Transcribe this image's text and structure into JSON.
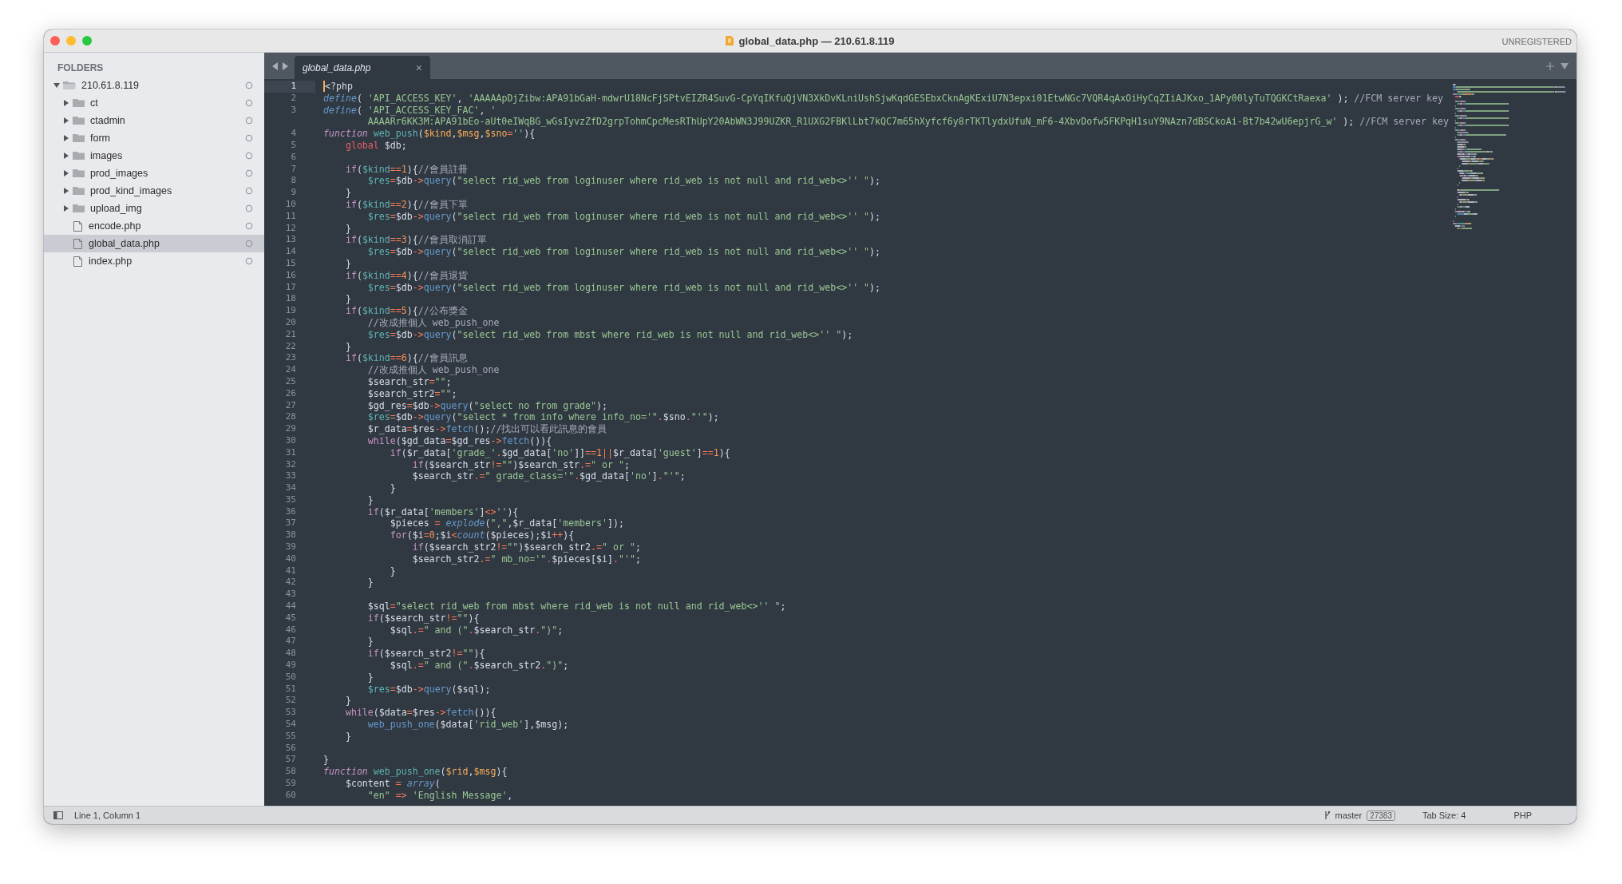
{
  "window": {
    "title": "global_data.php — 210.61.8.119",
    "registration": "UNREGISTERED"
  },
  "sidebar": {
    "heading": "FOLDERS",
    "items": [
      {
        "name": "210.61.8.119",
        "kind": "folder",
        "expanded": true,
        "selected": false,
        "children": [
          {
            "name": "ct",
            "kind": "folder",
            "expanded": false,
            "selected": false
          },
          {
            "name": "ctadmin",
            "kind": "folder",
            "expanded": false,
            "selected": false
          },
          {
            "name": "form",
            "kind": "folder",
            "expanded": false,
            "selected": false
          },
          {
            "name": "images",
            "kind": "folder",
            "expanded": false,
            "selected": false
          },
          {
            "name": "prod_images",
            "kind": "folder",
            "expanded": false,
            "selected": false
          },
          {
            "name": "prod_kind_images",
            "kind": "folder",
            "expanded": false,
            "selected": false
          },
          {
            "name": "upload_img",
            "kind": "folder",
            "expanded": false,
            "selected": false
          },
          {
            "name": "encode.php",
            "kind": "file",
            "selected": false
          },
          {
            "name": "global_data.php",
            "kind": "file",
            "selected": true
          },
          {
            "name": "index.php",
            "kind": "file",
            "selected": false
          }
        ]
      }
    ]
  },
  "tabs": [
    {
      "label": "global_data.php",
      "selected": true,
      "close": "×"
    }
  ],
  "editor": {
    "lines": [
      {
        "number": "1",
        "current": true,
        "tokens": [
          {
            "kind": "p",
            "text": "<?php"
          }
        ]
      },
      {
        "number": "2",
        "current": false,
        "tokens": [
          {
            "kind": "fi",
            "text": "define"
          },
          {
            "kind": "p",
            "text": "( "
          },
          {
            "kind": "s",
            "text": "'API_ACCESS_KEY'"
          },
          {
            "kind": "p",
            "text": ", "
          },
          {
            "kind": "s",
            "text": "'AAAAApDjZibw:APA91bGaH-mdwrU18NcFjSPtvEIZR4SuvG-CpYqIKfuQjVN3XkDvKLniUshSjwKqdGESEbxCknAgKExiU7N3epxi01EtwNGc7VQR4qAxOiHyCqZIiAJKxo_1APy00lyTuTQGKCtRaexa'"
          },
          {
            "kind": "p",
            "text": " ); "
          },
          {
            "kind": "c",
            "text": "//FCM server key"
          }
        ]
      },
      {
        "number": "3",
        "current": false,
        "tokens": [
          {
            "kind": "fi",
            "text": "define"
          },
          {
            "kind": "p",
            "text": "( "
          },
          {
            "kind": "s",
            "text": "'API_ACCESS_KEY_FAC'"
          },
          {
            "kind": "p",
            "text": ", "
          },
          {
            "kind": "s",
            "text": "'"
          }
        ]
      },
      {
        "current": false,
        "tokens": [
          {
            "kind": "s",
            "text": "        AAAARr6KK3M:APA91bEo-aUt0eIWqBG_wGsIyvzZfD2grpTohmCpcMesRThUpY20AbWN3J99UZKR_R1UXG2FBKlLbt7kQC7m65hXyfcf6y8rTKTlydxUfuN_mF6-4XbvDofw5FKPqH1suY9NAzn7dBSCkoAi-Bt7b42wU6epjrG_w'"
          },
          {
            "kind": "p",
            "text": " ); "
          },
          {
            "kind": "c",
            "text": "//FCM server key"
          }
        ]
      },
      {
        "number": "4",
        "current": false,
        "tokens": [
          {
            "kind": "fn",
            "text": "function"
          },
          {
            "kind": "v",
            "text": " web_push"
          },
          {
            "kind": "p",
            "text": "("
          },
          {
            "kind": "a",
            "text": "$kind"
          },
          {
            "kind": "p",
            "text": ","
          },
          {
            "kind": "a",
            "text": "$msg"
          },
          {
            "kind": "p",
            "text": ","
          },
          {
            "kind": "a",
            "text": "$sno"
          },
          {
            "kind": "o",
            "text": "="
          },
          {
            "kind": "s",
            "text": "''"
          },
          {
            "kind": "p",
            "text": "){"
          }
        ]
      },
      {
        "number": "5",
        "current": false,
        "tokens": [
          {
            "kind": "g",
            "text": "    global"
          },
          {
            "kind": "p",
            "text": " $db;"
          }
        ]
      },
      {
        "number": "6",
        "current": false
      },
      {
        "number": "7",
        "current": false,
        "tokens": [
          {
            "kind": "k",
            "text": "    if"
          },
          {
            "kind": "p",
            "text": "("
          },
          {
            "kind": "v",
            "text": "$kind"
          },
          {
            "kind": "o",
            "text": "=="
          },
          {
            "kind": "n",
            "text": "1"
          },
          {
            "kind": "p",
            "text": "){"
          },
          {
            "kind": "c",
            "text": "//會員註冊"
          }
        ]
      },
      {
        "number": "8",
        "current": false,
        "tokens": [
          {
            "kind": "v",
            "text": "        $res"
          },
          {
            "kind": "o",
            "text": "="
          },
          {
            "kind": "p",
            "text": "$db"
          },
          {
            "kind": "o",
            "text": "->"
          },
          {
            "kind": "f",
            "text": "query"
          },
          {
            "kind": "p",
            "text": "("
          },
          {
            "kind": "s",
            "text": "\"select rid_web from loginuser where rid_web is not null and rid_web<>'' \""
          },
          {
            "kind": "p",
            "text": ");"
          }
        ]
      },
      {
        "number": "9",
        "current": false,
        "tokens": [
          {
            "kind": "p",
            "text": "    }"
          }
        ]
      },
      {
        "number": "10",
        "current": false,
        "tokens": [
          {
            "kind": "k",
            "text": "    if"
          },
          {
            "kind": "p",
            "text": "("
          },
          {
            "kind": "v",
            "text": "$kind"
          },
          {
            "kind": "o",
            "text": "=="
          },
          {
            "kind": "n",
            "text": "2"
          },
          {
            "kind": "p",
            "text": "){"
          },
          {
            "kind": "c",
            "text": "//會員下單"
          }
        ]
      },
      {
        "number": "11",
        "current": false,
        "tokens": [
          {
            "kind": "v",
            "text": "        $res"
          },
          {
            "kind": "o",
            "text": "="
          },
          {
            "kind": "p",
            "text": "$db"
          },
          {
            "kind": "o",
            "text": "->"
          },
          {
            "kind": "f",
            "text": "query"
          },
          {
            "kind": "p",
            "text": "("
          },
          {
            "kind": "s",
            "text": "\"select rid_web from loginuser where rid_web is not null and rid_web<>'' \""
          },
          {
            "kind": "p",
            "text": ");"
          }
        ]
      },
      {
        "number": "12",
        "current": false,
        "tokens": [
          {
            "kind": "p",
            "text": "    }"
          }
        ]
      },
      {
        "number": "13",
        "current": false,
        "tokens": [
          {
            "kind": "k",
            "text": "    if"
          },
          {
            "kind": "p",
            "text": "("
          },
          {
            "kind": "v",
            "text": "$kind"
          },
          {
            "kind": "o",
            "text": "=="
          },
          {
            "kind": "n",
            "text": "3"
          },
          {
            "kind": "p",
            "text": "){"
          },
          {
            "kind": "c",
            "text": "//會員取消訂單"
          }
        ]
      },
      {
        "number": "14",
        "current": false,
        "tokens": [
          {
            "kind": "v",
            "text": "        $res"
          },
          {
            "kind": "o",
            "text": "="
          },
          {
            "kind": "p",
            "text": "$db"
          },
          {
            "kind": "o",
            "text": "->"
          },
          {
            "kind": "f",
            "text": "query"
          },
          {
            "kind": "p",
            "text": "("
          },
          {
            "kind": "s",
            "text": "\"select rid_web from loginuser where rid_web is not null and rid_web<>'' \""
          },
          {
            "kind": "p",
            "text": ");"
          }
        ]
      },
      {
        "number": "15",
        "current": false,
        "tokens": [
          {
            "kind": "p",
            "text": "    }"
          }
        ]
      },
      {
        "number": "16",
        "current": false,
        "tokens": [
          {
            "kind": "k",
            "text": "    if"
          },
          {
            "kind": "p",
            "text": "("
          },
          {
            "kind": "v",
            "text": "$kind"
          },
          {
            "kind": "o",
            "text": "=="
          },
          {
            "kind": "n",
            "text": "4"
          },
          {
            "kind": "p",
            "text": "){"
          },
          {
            "kind": "c",
            "text": "//會員退貨"
          }
        ]
      },
      {
        "number": "17",
        "current": false,
        "tokens": [
          {
            "kind": "v",
            "text": "        $res"
          },
          {
            "kind": "o",
            "text": "="
          },
          {
            "kind": "p",
            "text": "$db"
          },
          {
            "kind": "o",
            "text": "->"
          },
          {
            "kind": "f",
            "text": "query"
          },
          {
            "kind": "p",
            "text": "("
          },
          {
            "kind": "s",
            "text": "\"select rid_web from loginuser where rid_web is not null and rid_web<>'' \""
          },
          {
            "kind": "p",
            "text": ");"
          }
        ]
      },
      {
        "number": "18",
        "current": false,
        "tokens": [
          {
            "kind": "p",
            "text": "    }"
          }
        ]
      },
      {
        "number": "19",
        "current": false,
        "tokens": [
          {
            "kind": "k",
            "text": "    if"
          },
          {
            "kind": "p",
            "text": "("
          },
          {
            "kind": "v",
            "text": "$kind"
          },
          {
            "kind": "o",
            "text": "=="
          },
          {
            "kind": "n",
            "text": "5"
          },
          {
            "kind": "p",
            "text": "){"
          },
          {
            "kind": "c",
            "text": "//公布獎金"
          }
        ]
      },
      {
        "number": "20",
        "current": false,
        "tokens": [
          {
            "kind": "c",
            "text": "        //改成推個人 web_push_one"
          }
        ]
      },
      {
        "number": "21",
        "current": false,
        "tokens": [
          {
            "kind": "v",
            "text": "        $res"
          },
          {
            "kind": "o",
            "text": "="
          },
          {
            "kind": "p",
            "text": "$db"
          },
          {
            "kind": "o",
            "text": "->"
          },
          {
            "kind": "f",
            "text": "query"
          },
          {
            "kind": "p",
            "text": "("
          },
          {
            "kind": "s",
            "text": "\"select rid_web from mbst where rid_web is not null and rid_web<>'' \""
          },
          {
            "kind": "p",
            "text": ");"
          }
        ]
      },
      {
        "number": "22",
        "current": false,
        "tokens": [
          {
            "kind": "p",
            "text": "    }"
          }
        ]
      },
      {
        "number": "23",
        "current": false,
        "tokens": [
          {
            "kind": "k",
            "text": "    if"
          },
          {
            "kind": "p",
            "text": "("
          },
          {
            "kind": "v",
            "text": "$kind"
          },
          {
            "kind": "o",
            "text": "=="
          },
          {
            "kind": "n",
            "text": "6"
          },
          {
            "kind": "p",
            "text": "){"
          },
          {
            "kind": "c",
            "text": "//會員訊息"
          }
        ]
      },
      {
        "number": "24",
        "current": false,
        "tokens": [
          {
            "kind": "c",
            "text": "        //改成推個人 web_push_one"
          }
        ]
      },
      {
        "number": "25",
        "current": false,
        "tokens": [
          {
            "kind": "p",
            "text": "        $search_str"
          },
          {
            "kind": "o",
            "text": "="
          },
          {
            "kind": "s",
            "text": "\"\""
          },
          {
            "kind": "p",
            "text": ";"
          }
        ]
      },
      {
        "number": "26",
        "current": false,
        "tokens": [
          {
            "kind": "p",
            "text": "        $search_str2"
          },
          {
            "kind": "o",
            "text": "="
          },
          {
            "kind": "s",
            "text": "\"\""
          },
          {
            "kind": "p",
            "text": ";"
          }
        ]
      },
      {
        "number": "27",
        "current": false,
        "tokens": [
          {
            "kind": "p",
            "text": "        $gd_res"
          },
          {
            "kind": "o",
            "text": "="
          },
          {
            "kind": "p",
            "text": "$db"
          },
          {
            "kind": "o",
            "text": "->"
          },
          {
            "kind": "f",
            "text": "query"
          },
          {
            "kind": "p",
            "text": "("
          },
          {
            "kind": "s",
            "text": "\"select no from grade\""
          },
          {
            "kind": "p",
            "text": ");"
          }
        ]
      },
      {
        "number": "28",
        "current": false,
        "tokens": [
          {
            "kind": "v",
            "text": "        $res"
          },
          {
            "kind": "o",
            "text": "="
          },
          {
            "kind": "p",
            "text": "$db"
          },
          {
            "kind": "o",
            "text": "->"
          },
          {
            "kind": "f",
            "text": "query"
          },
          {
            "kind": "p",
            "text": "("
          },
          {
            "kind": "s",
            "text": "\"select * from info where info_no='\""
          },
          {
            "kind": "o",
            "text": "."
          },
          {
            "kind": "p",
            "text": "$sno"
          },
          {
            "kind": "o",
            "text": "."
          },
          {
            "kind": "s",
            "text": "\"'\""
          },
          {
            "kind": "p",
            "text": ");"
          }
        ]
      },
      {
        "number": "29",
        "current": false,
        "tokens": [
          {
            "kind": "p",
            "text": "        $r_data"
          },
          {
            "kind": "o",
            "text": "="
          },
          {
            "kind": "p",
            "text": "$res"
          },
          {
            "kind": "o",
            "text": "->"
          },
          {
            "kind": "f",
            "text": "fetch"
          },
          {
            "kind": "p",
            "text": "();"
          },
          {
            "kind": "c",
            "text": "//找出可以看此訊息的會員"
          }
        ]
      },
      {
        "number": "30",
        "current": false,
        "tokens": [
          {
            "kind": "k",
            "text": "        while"
          },
          {
            "kind": "p",
            "text": "($gd_data"
          },
          {
            "kind": "o",
            "text": "="
          },
          {
            "kind": "p",
            "text": "$gd_res"
          },
          {
            "kind": "o",
            "text": "->"
          },
          {
            "kind": "f",
            "text": "fetch"
          },
          {
            "kind": "p",
            "text": "()){"
          }
        ]
      },
      {
        "number": "31",
        "current": false,
        "tokens": [
          {
            "kind": "k",
            "text": "            if"
          },
          {
            "kind": "p",
            "text": "($r_data["
          },
          {
            "kind": "s",
            "text": "'grade_'"
          },
          {
            "kind": "o",
            "text": "."
          },
          {
            "kind": "p",
            "text": "$gd_data["
          },
          {
            "kind": "s",
            "text": "'no'"
          },
          {
            "kind": "p",
            "text": "]]"
          },
          {
            "kind": "o",
            "text": "=="
          },
          {
            "kind": "n",
            "text": "1"
          },
          {
            "kind": "o",
            "text": "||"
          },
          {
            "kind": "p",
            "text": "$r_data["
          },
          {
            "kind": "s",
            "text": "'guest'"
          },
          {
            "kind": "p",
            "text": "]"
          },
          {
            "kind": "o",
            "text": "=="
          },
          {
            "kind": "n",
            "text": "1"
          },
          {
            "kind": "p",
            "text": "){"
          }
        ]
      },
      {
        "number": "32",
        "current": false,
        "tokens": [
          {
            "kind": "k",
            "text": "                if"
          },
          {
            "kind": "p",
            "text": "($search_str"
          },
          {
            "kind": "o",
            "text": "!="
          },
          {
            "kind": "s",
            "text": "\"\""
          },
          {
            "kind": "p",
            "text": ")$search_str"
          },
          {
            "kind": "o",
            "text": ".="
          },
          {
            "kind": "s",
            "text": "\" or \""
          },
          {
            "kind": "p",
            "text": ";"
          }
        ]
      },
      {
        "number": "33",
        "current": false,
        "tokens": [
          {
            "kind": "p",
            "text": "                $search_str"
          },
          {
            "kind": "o",
            "text": ".="
          },
          {
            "kind": "s",
            "text": "\" grade_class='\""
          },
          {
            "kind": "o",
            "text": "."
          },
          {
            "kind": "p",
            "text": "$gd_data["
          },
          {
            "kind": "s",
            "text": "'no'"
          },
          {
            "kind": "p",
            "text": "]"
          },
          {
            "kind": "o",
            "text": "."
          },
          {
            "kind": "s",
            "text": "\"'\""
          },
          {
            "kind": "p",
            "text": ";"
          }
        ]
      },
      {
        "number": "34",
        "current": false,
        "tokens": [
          {
            "kind": "p",
            "text": "            }"
          }
        ]
      },
      {
        "number": "35",
        "current": false,
        "tokens": [
          {
            "kind": "p",
            "text": "        }"
          }
        ]
      },
      {
        "number": "36",
        "current": false,
        "tokens": [
          {
            "kind": "k",
            "text": "        if"
          },
          {
            "kind": "p",
            "text": "($r_data["
          },
          {
            "kind": "s",
            "text": "'members'"
          },
          {
            "kind": "p",
            "text": "]"
          },
          {
            "kind": "o",
            "text": "<>"
          },
          {
            "kind": "s",
            "text": "''"
          },
          {
            "kind": "p",
            "text": "){"
          }
        ]
      },
      {
        "number": "37",
        "current": false,
        "tokens": [
          {
            "kind": "p",
            "text": "            $pieces "
          },
          {
            "kind": "o",
            "text": "="
          },
          {
            "kind": "fi",
            "text": " explode"
          },
          {
            "kind": "p",
            "text": "("
          },
          {
            "kind": "s",
            "text": "\",\""
          },
          {
            "kind": "p",
            "text": ",$r_data["
          },
          {
            "kind": "s",
            "text": "'members'"
          },
          {
            "kind": "p",
            "text": "]);"
          }
        ]
      },
      {
        "number": "38",
        "current": false,
        "tokens": [
          {
            "kind": "k",
            "text": "            for"
          },
          {
            "kind": "p",
            "text": "($i"
          },
          {
            "kind": "o",
            "text": "="
          },
          {
            "kind": "n",
            "text": "0"
          },
          {
            "kind": "p",
            "text": ";$i"
          },
          {
            "kind": "o",
            "text": "<"
          },
          {
            "kind": "fi",
            "text": "count"
          },
          {
            "kind": "p",
            "text": "($pieces);$i"
          },
          {
            "kind": "o",
            "text": "++"
          },
          {
            "kind": "p",
            "text": "){"
          }
        ]
      },
      {
        "number": "39",
        "current": false,
        "tokens": [
          {
            "kind": "k",
            "text": "                if"
          },
          {
            "kind": "p",
            "text": "($search_str2"
          },
          {
            "kind": "o",
            "text": "!="
          },
          {
            "kind": "s",
            "text": "\"\""
          },
          {
            "kind": "p",
            "text": ")$search_str2"
          },
          {
            "kind": "o",
            "text": ".="
          },
          {
            "kind": "s",
            "text": "\" or \""
          },
          {
            "kind": "p",
            "text": ";"
          }
        ]
      },
      {
        "number": "40",
        "current": false,
        "tokens": [
          {
            "kind": "p",
            "text": "                $search_str2"
          },
          {
            "kind": "o",
            "text": ".="
          },
          {
            "kind": "s",
            "text": "\" mb_no='\""
          },
          {
            "kind": "o",
            "text": "."
          },
          {
            "kind": "p",
            "text": "$pieces[$i]"
          },
          {
            "kind": "o",
            "text": "."
          },
          {
            "kind": "s",
            "text": "\"'\""
          },
          {
            "kind": "p",
            "text": ";"
          }
        ]
      },
      {
        "number": "41",
        "current": false,
        "tokens": [
          {
            "kind": "p",
            "text": "            }"
          }
        ]
      },
      {
        "number": "42",
        "current": false,
        "tokens": [
          {
            "kind": "p",
            "text": "        }"
          }
        ]
      },
      {
        "number": "43",
        "current": false
      },
      {
        "number": "44",
        "current": false,
        "tokens": [
          {
            "kind": "p",
            "text": "        $sql"
          },
          {
            "kind": "o",
            "text": "="
          },
          {
            "kind": "s",
            "text": "\"select rid_web from mbst where rid_web is not null and rid_web<>'' \""
          },
          {
            "kind": "p",
            "text": ";"
          }
        ]
      },
      {
        "number": "45",
        "current": false,
        "tokens": [
          {
            "kind": "k",
            "text": "        if"
          },
          {
            "kind": "p",
            "text": "($search_str"
          },
          {
            "kind": "o",
            "text": "!="
          },
          {
            "kind": "s",
            "text": "\"\""
          },
          {
            "kind": "p",
            "text": "){"
          }
        ]
      },
      {
        "number": "46",
        "current": false,
        "tokens": [
          {
            "kind": "p",
            "text": "            $sql"
          },
          {
            "kind": "o",
            "text": ".="
          },
          {
            "kind": "s",
            "text": "\" and (\""
          },
          {
            "kind": "o",
            "text": "."
          },
          {
            "kind": "p",
            "text": "$search_str"
          },
          {
            "kind": "o",
            "text": "."
          },
          {
            "kind": "s",
            "text": "\")\""
          },
          {
            "kind": "p",
            "text": ";"
          }
        ]
      },
      {
        "number": "47",
        "current": false,
        "tokens": [
          {
            "kind": "p",
            "text": "        }"
          }
        ]
      },
      {
        "number": "48",
        "current": false,
        "tokens": [
          {
            "kind": "k",
            "text": "        if"
          },
          {
            "kind": "p",
            "text": "($search_str2"
          },
          {
            "kind": "o",
            "text": "!="
          },
          {
            "kind": "s",
            "text": "\"\""
          },
          {
            "kind": "p",
            "text": "){"
          }
        ]
      },
      {
        "number": "49",
        "current": false,
        "tokens": [
          {
            "kind": "p",
            "text": "            $sql"
          },
          {
            "kind": "o",
            "text": ".="
          },
          {
            "kind": "s",
            "text": "\" and (\""
          },
          {
            "kind": "o",
            "text": "."
          },
          {
            "kind": "p",
            "text": "$search_str2"
          },
          {
            "kind": "o",
            "text": "."
          },
          {
            "kind": "s",
            "text": "\")\""
          },
          {
            "kind": "p",
            "text": ";"
          }
        ]
      },
      {
        "number": "50",
        "current": false,
        "tokens": [
          {
            "kind": "p",
            "text": "        }"
          }
        ]
      },
      {
        "number": "51",
        "current": false,
        "tokens": [
          {
            "kind": "v",
            "text": "        $res"
          },
          {
            "kind": "o",
            "text": "="
          },
          {
            "kind": "p",
            "text": "$db"
          },
          {
            "kind": "o",
            "text": "->"
          },
          {
            "kind": "f",
            "text": "query"
          },
          {
            "kind": "p",
            "text": "($sql);"
          }
        ]
      },
      {
        "number": "52",
        "current": false,
        "tokens": [
          {
            "kind": "p",
            "text": "    }"
          }
        ]
      },
      {
        "number": "53",
        "current": false,
        "tokens": [
          {
            "kind": "k",
            "text": "    while"
          },
          {
            "kind": "p",
            "text": "($data"
          },
          {
            "kind": "o",
            "text": "="
          },
          {
            "kind": "p",
            "text": "$res"
          },
          {
            "kind": "o",
            "text": "->"
          },
          {
            "kind": "f",
            "text": "fetch"
          },
          {
            "kind": "p",
            "text": "()){"
          }
        ]
      },
      {
        "number": "54",
        "current": false,
        "tokens": [
          {
            "kind": "f",
            "text": "        web_push_one"
          },
          {
            "kind": "p",
            "text": "($data["
          },
          {
            "kind": "s",
            "text": "'rid_web'"
          },
          {
            "kind": "p",
            "text": "],$msg);"
          }
        ]
      },
      {
        "number": "55",
        "current": false,
        "tokens": [
          {
            "kind": "p",
            "text": "    }"
          }
        ]
      },
      {
        "number": "56",
        "current": false
      },
      {
        "number": "57",
        "current": false,
        "tokens": [
          {
            "kind": "p",
            "text": "}"
          }
        ]
      },
      {
        "number": "58",
        "current": false,
        "tokens": [
          {
            "kind": "fn",
            "text": "function"
          },
          {
            "kind": "v",
            "text": " web_push_one"
          },
          {
            "kind": "p",
            "text": "("
          },
          {
            "kind": "a",
            "text": "$rid"
          },
          {
            "kind": "p",
            "text": ","
          },
          {
            "kind": "a",
            "text": "$msg"
          },
          {
            "kind": "p",
            "text": "){"
          }
        ]
      },
      {
        "number": "59",
        "current": false,
        "tokens": [
          {
            "kind": "p",
            "text": "    $content "
          },
          {
            "kind": "o",
            "text": "="
          },
          {
            "kind": "fi",
            "text": " array"
          },
          {
            "kind": "p",
            "text": "("
          }
        ]
      },
      {
        "number": "60",
        "current": false,
        "tokens": [
          {
            "kind": "s",
            "text": "        \"en\""
          },
          {
            "kind": "o",
            "text": " =>"
          },
          {
            "kind": "s",
            "text": " 'English Message'"
          },
          {
            "kind": "p",
            "text": ","
          }
        ]
      }
    ]
  },
  "status_bar": {
    "position": "Line 1, Column 1",
    "branch": "master",
    "changes": "27383",
    "tab_size": "Tab Size: 4",
    "syntax": "PHP"
  }
}
